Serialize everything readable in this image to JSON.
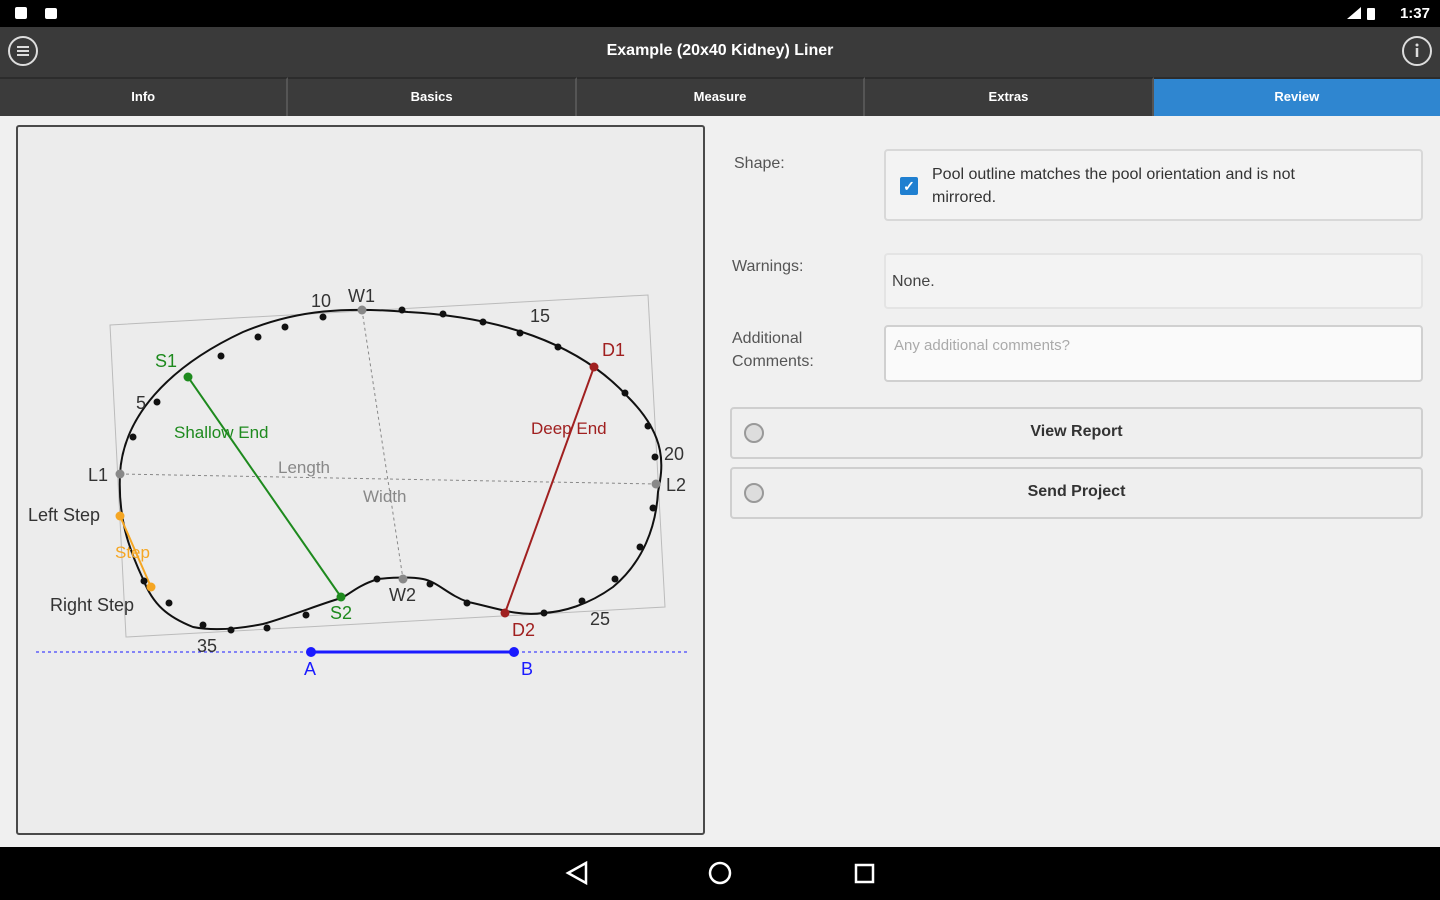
{
  "status_bar": {
    "time": "1:37"
  },
  "app_bar": {
    "title": "Example (20x40 Kidney) Liner"
  },
  "tabs": [
    {
      "label": "Info"
    },
    {
      "label": "Basics"
    },
    {
      "label": "Measure"
    },
    {
      "label": "Extras"
    },
    {
      "label": "Review"
    }
  ],
  "active_tab": "Review",
  "diagram": {
    "vertex_labels": {
      "w1": "W1",
      "w2": "W2",
      "s1": "S1",
      "s2": "S2",
      "d1": "D1",
      "d2": "D2",
      "l1": "L1",
      "l2": "L2",
      "a": "A",
      "b": "B"
    },
    "number_labels": [
      "5",
      "10",
      "15",
      "20",
      "25",
      "35"
    ],
    "line_labels": {
      "shallow_end": "Shallow End",
      "deep_end": "Deep End",
      "length": "Length",
      "width": "Width",
      "step": "Step",
      "left_step": "Left Step",
      "right_step": "Right Step"
    },
    "colors": {
      "shallow": "#1e8a1e",
      "deep": "#a02020",
      "step": "#f5a623",
      "baseline": "#1a1aff",
      "outline": "#111111",
      "guide": "#888888"
    }
  },
  "form": {
    "shape_label": "Shape:",
    "shape_checkbox_text": "Pool outline matches the pool orientation and is not mirrored.",
    "shape_checked": true,
    "warnings_label": "Warnings:",
    "warnings_value": "None.",
    "comments_label": "Additional Comments:",
    "comments_placeholder": "Any additional comments?",
    "view_report_label": "View Report",
    "send_project_label": "Send Project"
  }
}
